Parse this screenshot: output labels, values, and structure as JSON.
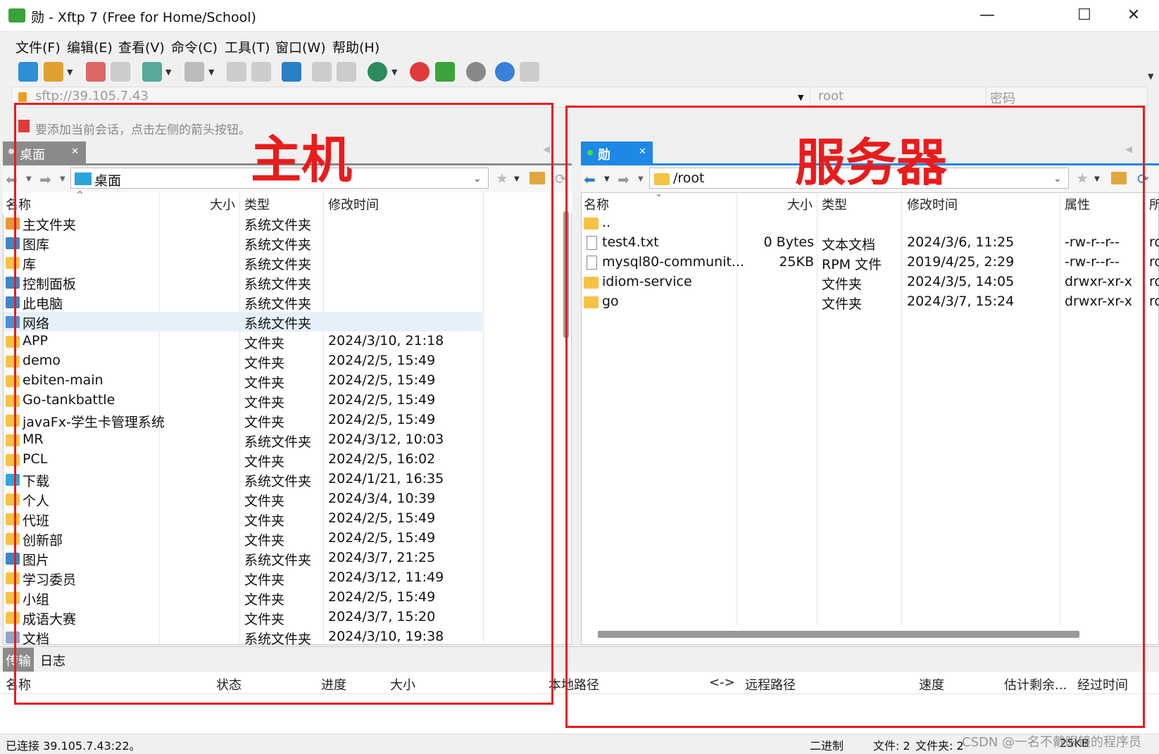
{
  "window": {
    "title": "勋 - Xftp 7 (Free for Home/School)",
    "minimize": "—",
    "maximize": "☐",
    "close": "✕"
  },
  "menu": [
    "文件(F)",
    "编辑(E)",
    "查看(V)",
    "命令(C)",
    "工具(T)",
    "窗口(W)",
    "帮助(H)"
  ],
  "address": {
    "value": "sftp://39.105.7.43",
    "user_placeholder": "root",
    "password_placeholder": "密码"
  },
  "hint": "要添加当前会话，点击左侧的箭头按钮。",
  "annotations": {
    "local_label": "主机",
    "remote_label": "服务器"
  },
  "local": {
    "tab": "桌面",
    "path": "桌面",
    "columns": [
      "名称",
      "大小",
      "类型",
      "修改时间"
    ],
    "rows": [
      {
        "name": "主文件夹",
        "type": "系统文件夹",
        "time": "",
        "icon": "home-icon"
      },
      {
        "name": "图库",
        "type": "系统文件夹",
        "time": "",
        "icon": "gallery-icon"
      },
      {
        "name": "库",
        "type": "系统文件夹",
        "time": "",
        "icon": "folder-icon"
      },
      {
        "name": "控制面板",
        "type": "系统文件夹",
        "time": "",
        "icon": "control-panel-icon"
      },
      {
        "name": "此电脑",
        "type": "系统文件夹",
        "time": "",
        "icon": "computer-icon"
      },
      {
        "name": "网络",
        "type": "系统文件夹",
        "time": "",
        "icon": "network-icon"
      },
      {
        "name": "APP",
        "type": "文件夹",
        "time": "2024/3/10, 21:18",
        "icon": "folder-icon"
      },
      {
        "name": "demo",
        "type": "文件夹",
        "time": "2024/2/5, 15:49",
        "icon": "folder-icon"
      },
      {
        "name": "ebiten-main",
        "type": "文件夹",
        "time": "2024/2/5, 15:49",
        "icon": "folder-icon"
      },
      {
        "name": "Go-tankbattle",
        "type": "文件夹",
        "time": "2024/2/5, 15:49",
        "icon": "folder-icon"
      },
      {
        "name": "javaFx-学生卡管理系统",
        "type": "文件夹",
        "time": "2024/2/5, 15:49",
        "icon": "folder-icon"
      },
      {
        "name": "MR",
        "type": "系统文件夹",
        "time": "2024/3/12, 10:03",
        "icon": "folder-icon"
      },
      {
        "name": "PCL",
        "type": "文件夹",
        "time": "2024/2/5, 16:02",
        "icon": "folder-icon"
      },
      {
        "name": "下载",
        "type": "系统文件夹",
        "time": "2024/1/21, 16:35",
        "icon": "download-icon"
      },
      {
        "name": "个人",
        "type": "文件夹",
        "time": "2024/3/4, 10:39",
        "icon": "folder-icon"
      },
      {
        "name": "代班",
        "type": "文件夹",
        "time": "2024/2/5, 15:49",
        "icon": "folder-icon"
      },
      {
        "name": "创新部",
        "type": "文件夹",
        "time": "2024/2/5, 15:49",
        "icon": "folder-icon"
      },
      {
        "name": "图片",
        "type": "系统文件夹",
        "time": "2024/3/7, 21:25",
        "icon": "pictures-icon"
      },
      {
        "name": "学习委员",
        "type": "文件夹",
        "time": "2024/3/12, 11:49",
        "icon": "folder-icon"
      },
      {
        "name": "小组",
        "type": "文件夹",
        "time": "2024/2/5, 15:49",
        "icon": "folder-icon"
      },
      {
        "name": "成语大赛",
        "type": "文件夹",
        "time": "2024/3/7, 15:20",
        "icon": "folder-icon"
      },
      {
        "name": "文档",
        "type": "系统文件夹",
        "time": "2024/3/10, 19:38",
        "icon": "documents-icon"
      }
    ]
  },
  "remote": {
    "tab": "勋",
    "path": "/root",
    "columns": [
      "名称",
      "大小",
      "类型",
      "修改时间",
      "属性",
      "所"
    ],
    "rows": [
      {
        "name": "..",
        "size": "",
        "type": "",
        "time": "",
        "attr": "",
        "owner": "",
        "icon": "folder-icon"
      },
      {
        "name": "test4.txt",
        "size": "0 Bytes",
        "type": "文本文档",
        "time": "2024/3/6, 11:25",
        "attr": "-rw-r--r--",
        "owner": "ro",
        "icon": "file-icon"
      },
      {
        "name": "mysql80-communit...",
        "size": "25KB",
        "type": "RPM 文件",
        "time": "2019/4/25, 2:29",
        "attr": "-rw-r--r--",
        "owner": "ro",
        "icon": "file-icon"
      },
      {
        "name": "idiom-service",
        "size": "",
        "type": "文件夹",
        "time": "2024/3/5, 14:05",
        "attr": "drwxr-xr-x",
        "owner": "ro",
        "icon": "folder-icon"
      },
      {
        "name": "go",
        "size": "",
        "type": "文件夹",
        "time": "2024/3/7, 15:24",
        "attr": "drwxr-xr-x",
        "owner": "ro",
        "icon": "folder-icon"
      }
    ]
  },
  "transfer": {
    "tabs": [
      "传输",
      "日志"
    ],
    "columns": [
      "名称",
      "状态",
      "进度",
      "大小",
      "本地路径",
      "<->",
      "远程路径",
      "速度",
      "估计剩余...",
      "经过时间"
    ]
  },
  "status": {
    "connected": "已连接 39.105.7.43:22。",
    "mode": "二进制",
    "files": "文件: 2",
    "folders": "文件夹: 2",
    "size": "25KB",
    "watermark": "CSDN @一名不戴眼镜的程序员"
  }
}
